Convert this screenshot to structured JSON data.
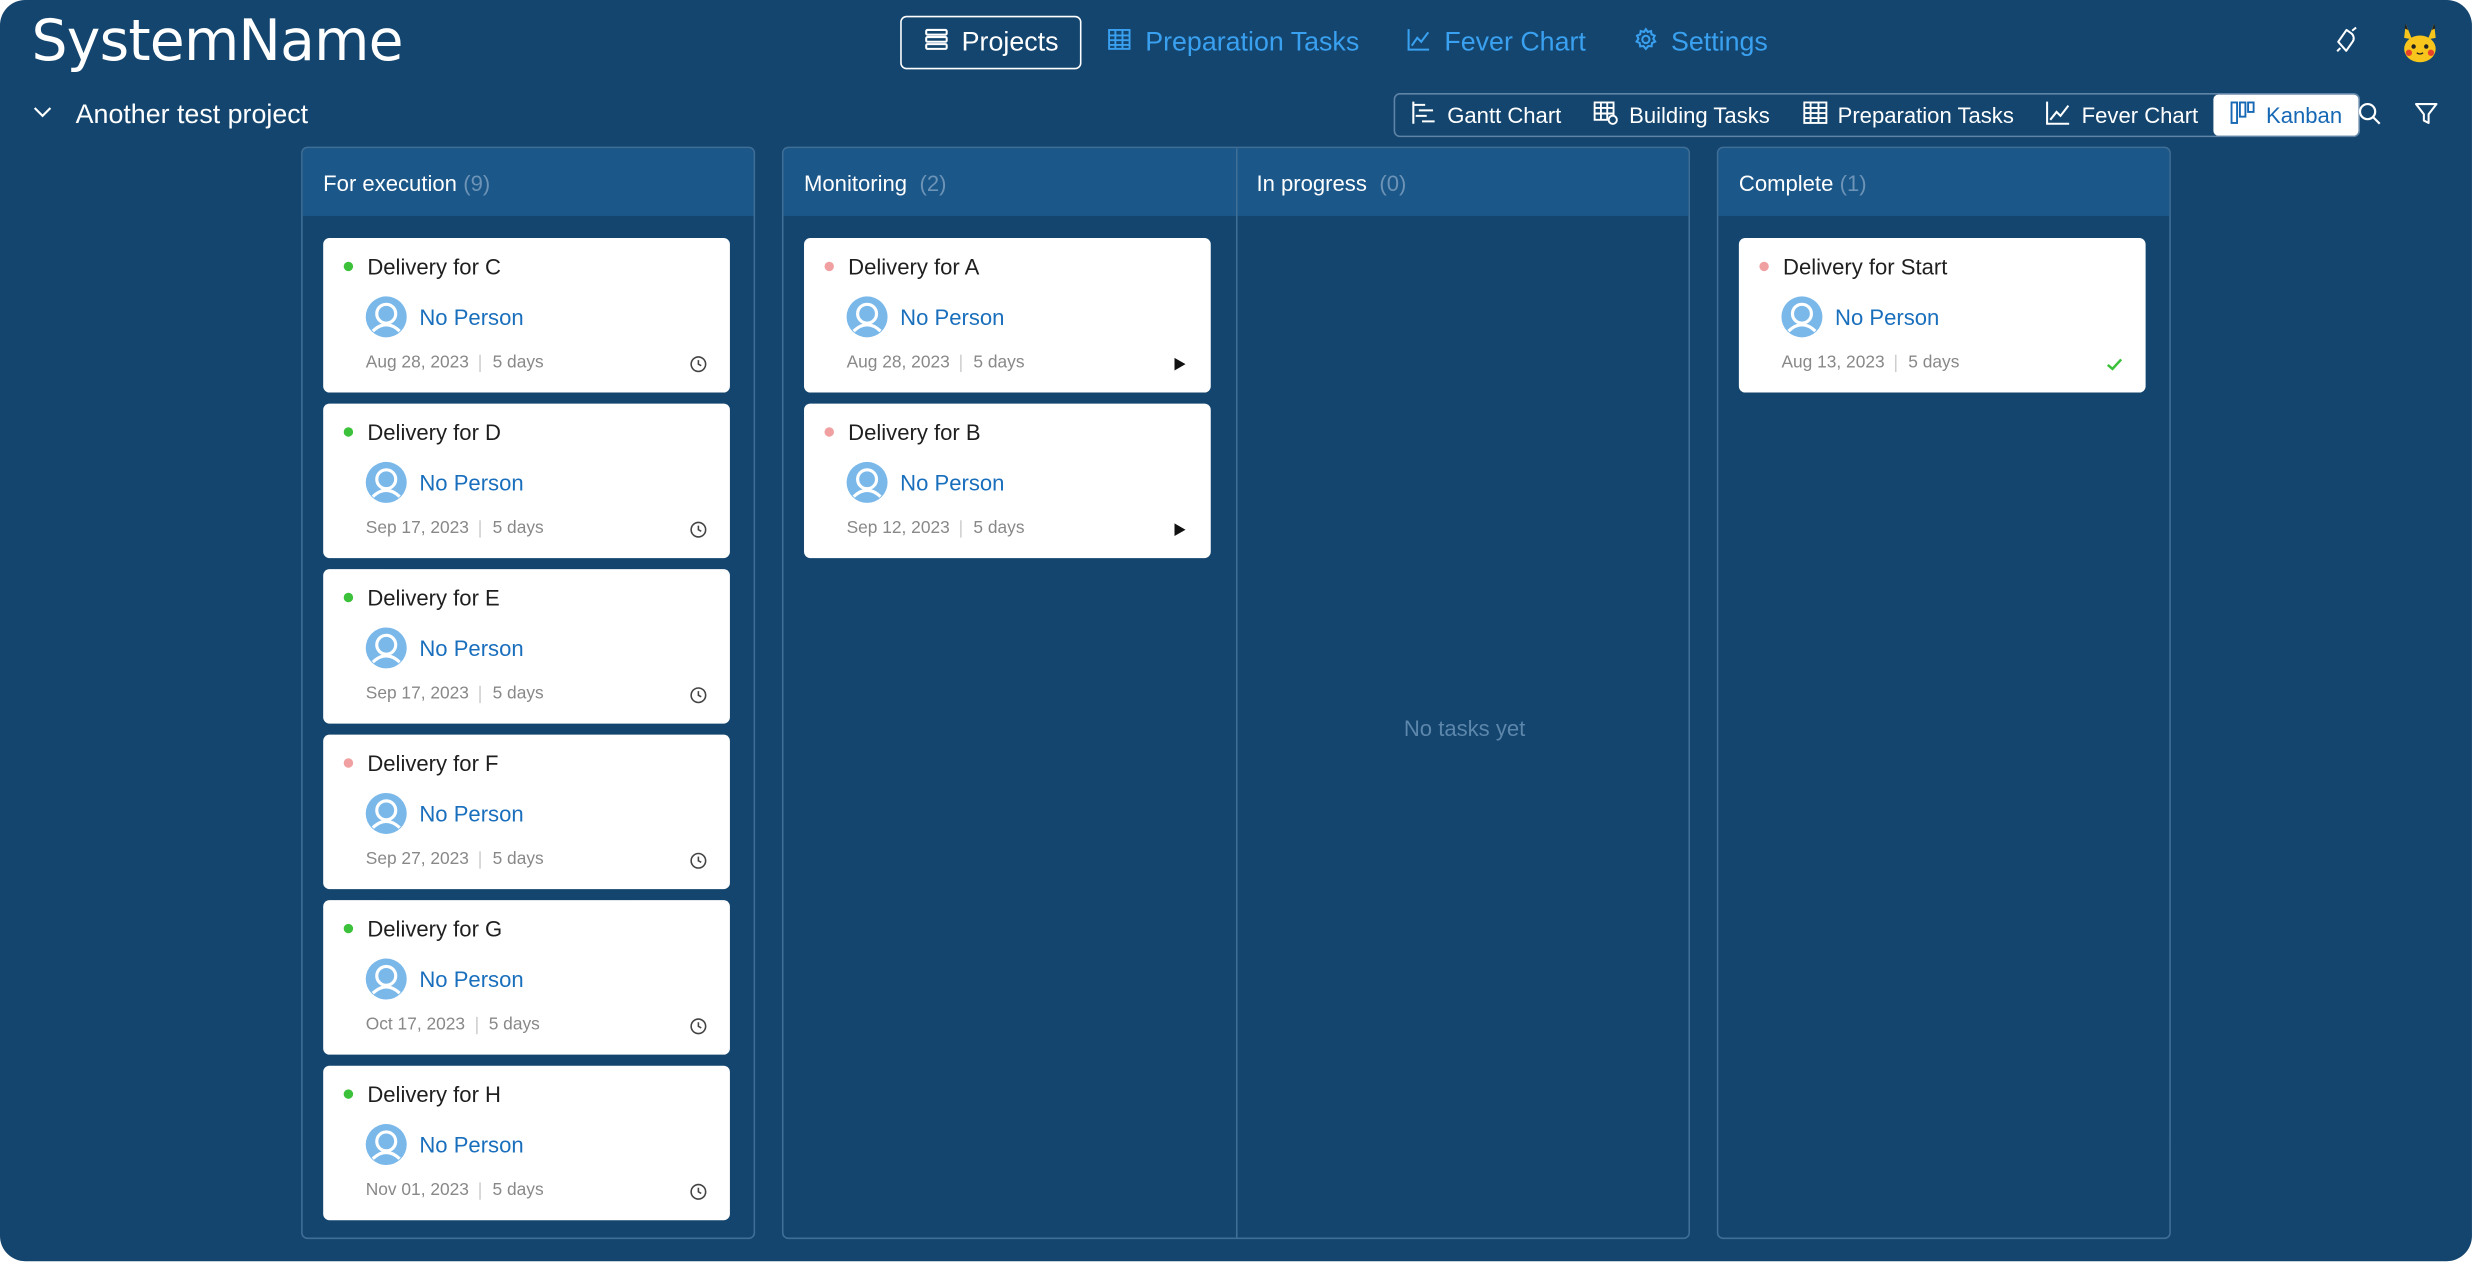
{
  "app": {
    "name": "SystemName"
  },
  "topnav": {
    "items": [
      {
        "label": "Projects",
        "icon": "list-icon",
        "active": true
      },
      {
        "label": "Preparation Tasks",
        "icon": "table-icon",
        "active": false
      },
      {
        "label": "Fever Chart",
        "icon": "line-chart-icon",
        "active": false
      },
      {
        "label": "Settings",
        "icon": "gear-icon",
        "active": false
      }
    ]
  },
  "project": {
    "title": "Another test project"
  },
  "views": [
    {
      "label": "Gantt Chart",
      "icon": "gantt-icon",
      "active": false
    },
    {
      "label": "Building Tasks",
      "icon": "building-tasks-icon",
      "active": false
    },
    {
      "label": "Preparation Tasks",
      "icon": "table-icon",
      "active": false
    },
    {
      "label": "Fever Chart",
      "icon": "line-chart-icon",
      "active": false
    },
    {
      "label": "Kanban",
      "icon": "kanban-icon",
      "active": true
    }
  ],
  "colors": {
    "background": "#13456e",
    "column_header": "#1b5789",
    "accent_blue": "#3aa0f0",
    "link_blue": "#1a6fbd",
    "dot_green": "#3cc13b",
    "dot_red": "#f0a0a0",
    "check_green": "#3cc13b"
  },
  "columns": [
    {
      "title": "For execution",
      "count": "(9)",
      "cards": [
        {
          "title": "Delivery for C",
          "dot": "green",
          "person": "No Person",
          "date": "Aug 28, 2023",
          "duration": "5 days",
          "status": "clock-icon"
        },
        {
          "title": "Delivery for D",
          "dot": "green",
          "person": "No Person",
          "date": "Sep 17, 2023",
          "duration": "5 days",
          "status": "clock-icon"
        },
        {
          "title": "Delivery for E",
          "dot": "green",
          "person": "No Person",
          "date": "Sep 17, 2023",
          "duration": "5 days",
          "status": "clock-icon"
        },
        {
          "title": "Delivery for F",
          "dot": "red",
          "person": "No Person",
          "date": "Sep 27, 2023",
          "duration": "5 days",
          "status": "clock-icon"
        },
        {
          "title": "Delivery for G",
          "dot": "green",
          "person": "No Person",
          "date": "Oct 17, 2023",
          "duration": "5 days",
          "status": "clock-icon"
        },
        {
          "title": "Delivery for H",
          "dot": "green",
          "person": "No Person",
          "date": "Nov 01, 2023",
          "duration": "5 days",
          "status": "clock-icon"
        }
      ]
    },
    {
      "title": "Monitoring",
      "count": "(2)",
      "cards": [
        {
          "title": "Delivery for A",
          "dot": "red",
          "person": "No Person",
          "date": "Aug 28, 2023",
          "duration": "5 days",
          "status": "play-icon"
        },
        {
          "title": "Delivery for B",
          "dot": "red",
          "person": "No Person",
          "date": "Sep 12, 2023",
          "duration": "5 days",
          "status": "play-icon"
        }
      ]
    },
    {
      "title": "In progress",
      "count": "(0)",
      "cards": [],
      "empty_text": "No tasks yet"
    },
    {
      "title": "Complete",
      "count": "(1)",
      "cards": [
        {
          "title": "Delivery for Start",
          "dot": "red",
          "person": "No Person",
          "date": "Aug 13, 2023",
          "duration": "5 days",
          "status": "check-icon"
        }
      ]
    }
  ]
}
